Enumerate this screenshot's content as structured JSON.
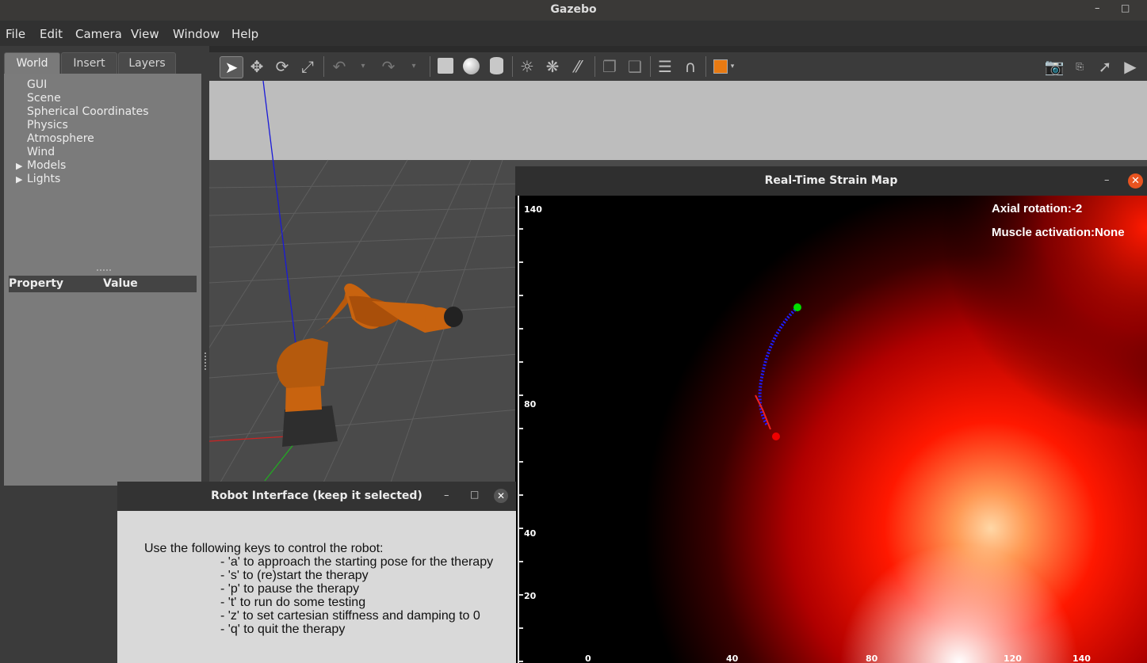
{
  "window": {
    "title": "Gazebo"
  },
  "menu": [
    "File",
    "Edit",
    "Camera",
    "View",
    "Window",
    "Help"
  ],
  "tabs": [
    "World",
    "Insert",
    "Layers"
  ],
  "tree": {
    "items": [
      "GUI",
      "Scene",
      "Spherical Coordinates",
      "Physics",
      "Atmosphere",
      "Wind"
    ],
    "expandable": [
      "Models",
      "Lights"
    ]
  },
  "props": {
    "property": "Property",
    "value": "Value"
  },
  "strain": {
    "title": "Real-Time Strain Map",
    "axial": "Axial rotation:-2",
    "muscle": "Muscle activation:None",
    "ylabels": [
      "140",
      "80",
      "40",
      "20"
    ],
    "xlabels": [
      "0",
      "40",
      "80",
      "120",
      "140"
    ]
  },
  "robot": {
    "title": "Robot Interface (keep it selected)",
    "intro": "Use the following keys to control the robot:",
    "keys": [
      "- 'a' to approach the starting pose for the therapy",
      "- 's' to (re)start the therapy",
      "- 'p' to pause the therapy",
      "- 't' to run do some testing",
      "- 'z' to set cartesian stiffness and damping to 0",
      "- 'q' to quit the therapy"
    ]
  },
  "colors": {
    "robot_arm": "#c8630f",
    "path": "#1d1dff",
    "start": "#00dd00",
    "end": "#ee0000",
    "heat_hot": "#ffffff",
    "heat_mid": "#ff0000"
  }
}
